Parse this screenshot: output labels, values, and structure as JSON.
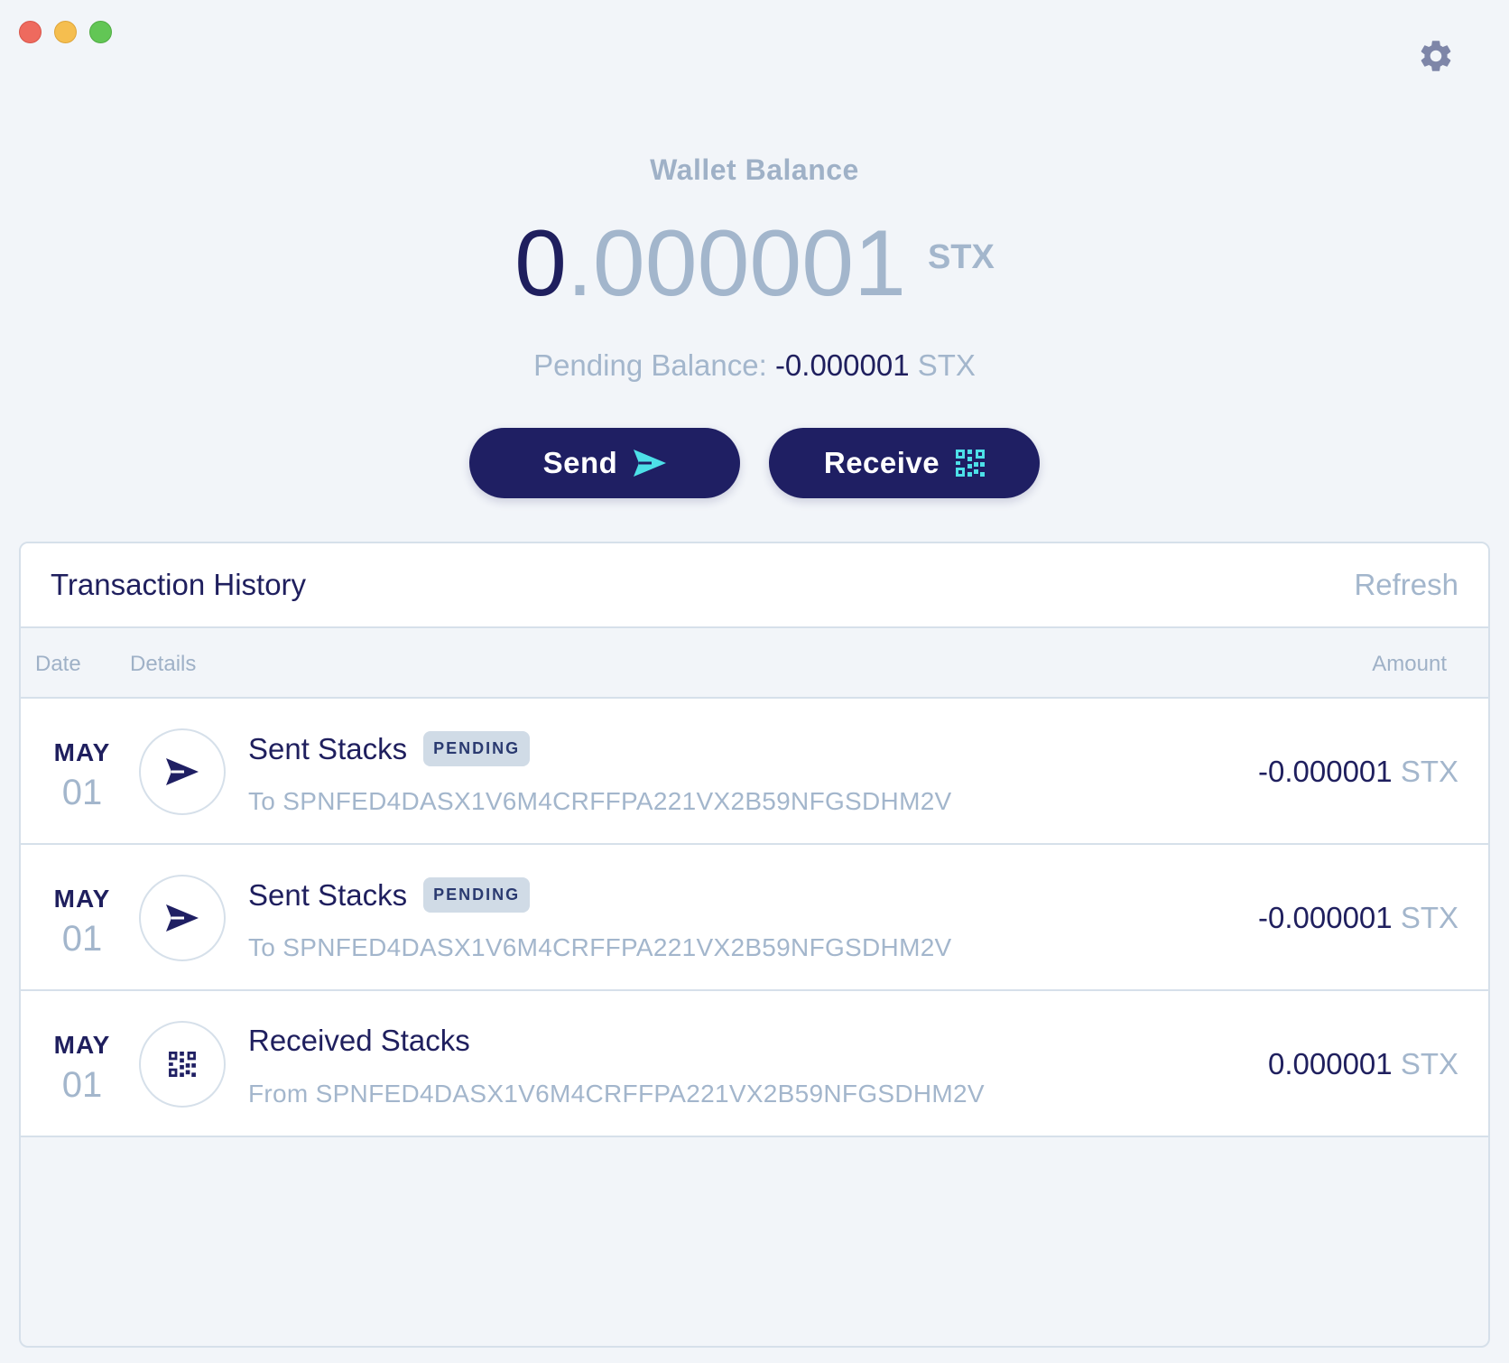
{
  "window": {
    "controls": [
      "close",
      "minimize",
      "maximize"
    ],
    "settings_icon": "gear-icon"
  },
  "balance": {
    "label": "Wallet Balance",
    "integer": "0",
    "fraction": ".000001",
    "unit": "STX"
  },
  "pending": {
    "label": "Pending Balance:",
    "value": "-0.000001",
    "unit": "STX"
  },
  "actions": {
    "send_label": "Send",
    "send_icon": "paper-plane-icon",
    "receive_label": "Receive",
    "receive_icon": "qr-code-icon"
  },
  "history": {
    "title": "Transaction History",
    "refresh_label": "Refresh",
    "columns": {
      "date": "Date",
      "details": "Details",
      "amount": "Amount"
    },
    "rows": [
      {
        "month": "MAY",
        "day": "01",
        "icon": "paper-plane-icon",
        "title": "Sent Stacks",
        "badge": "PENDING",
        "address": "To SPNFED4DASX1V6M4CRFFPA221VX2B59NFGSDHM2V",
        "amount": "-0.000001",
        "unit": "STX"
      },
      {
        "month": "MAY",
        "day": "01",
        "icon": "paper-plane-icon",
        "title": "Sent Stacks",
        "badge": "PENDING",
        "address": "To SPNFED4DASX1V6M4CRFFPA221VX2B59NFGSDHM2V",
        "amount": "-0.000001",
        "unit": "STX"
      },
      {
        "month": "MAY",
        "day": "01",
        "icon": "qr-code-icon",
        "title": "Received Stacks",
        "badge": "",
        "address": "From SPNFED4DASX1V6M4CRFFPA221VX2B59NFGSDHM2V",
        "amount": "0.000001",
        "unit": "STX"
      }
    ]
  },
  "colors": {
    "primary": "#1f1f63",
    "accent": "#4de0e8",
    "muted": "#a3b6cc",
    "background": "#f2f5f9"
  }
}
